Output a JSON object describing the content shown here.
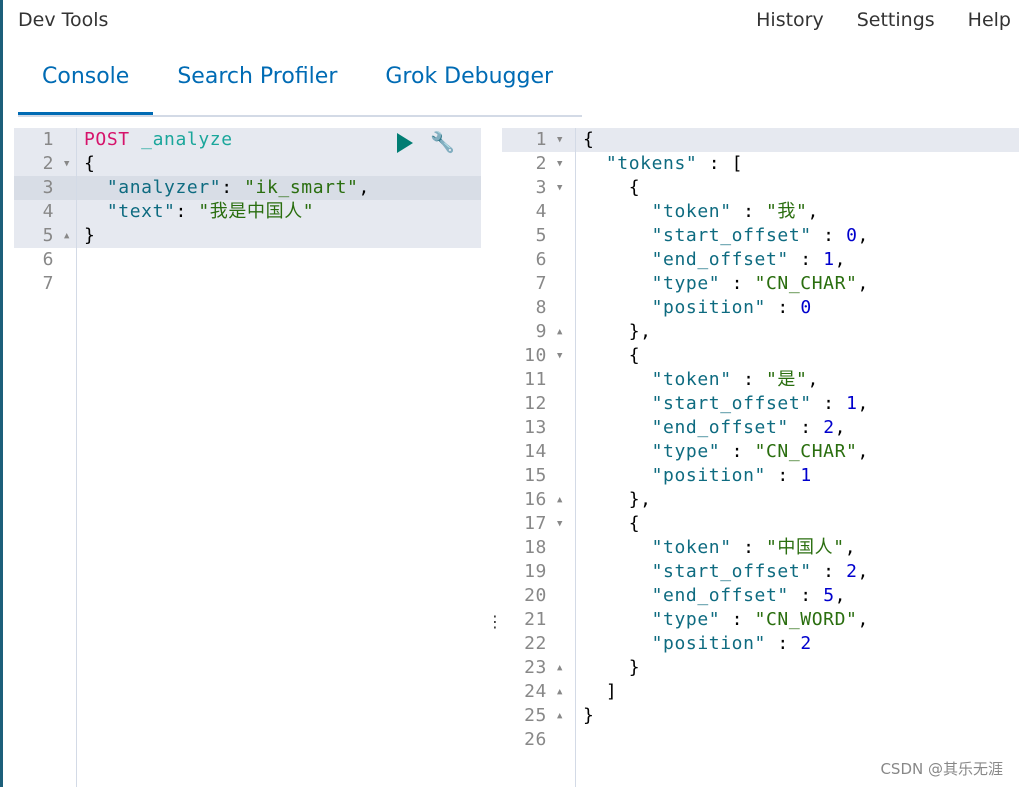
{
  "header": {
    "title": "Dev Tools",
    "nav": [
      "History",
      "Settings",
      "Help"
    ]
  },
  "tabs": [
    "Console",
    "Search Profiler",
    "Grok Debugger"
  ],
  "active_tab": 0,
  "icons": {
    "run": "play-icon",
    "settings": "wrench-icon",
    "splitter": "vertical-dots-icon"
  },
  "colors": {
    "accent": "#006bb4",
    "run": "#017d73"
  },
  "request": {
    "lines": [
      [
        [
          "POST",
          "m"
        ],
        [
          " _analyze",
          "u"
        ]
      ],
      [
        [
          "{",
          "p"
        ]
      ],
      [
        [
          "  \"analyzer\"",
          "k"
        ],
        [
          ": ",
          "p"
        ],
        [
          "\"ik_smart\"",
          "s"
        ],
        [
          ",",
          "p"
        ]
      ],
      [
        [
          "  \"text\"",
          "k"
        ],
        [
          ": ",
          "p"
        ],
        [
          "\"我是中国人\"",
          "s"
        ]
      ],
      [
        [
          "}",
          "p"
        ]
      ],
      [],
      []
    ],
    "folds": {
      "2": "down",
      "5": "up"
    }
  },
  "response": {
    "lines": [
      [
        [
          "{",
          "p"
        ]
      ],
      [
        [
          "  \"tokens\"",
          "k"
        ],
        [
          " : [",
          "p"
        ]
      ],
      [
        [
          "    {",
          "p"
        ]
      ],
      [
        [
          "      \"token\"",
          "k"
        ],
        [
          " : ",
          "p"
        ],
        [
          "\"我\"",
          "s"
        ],
        [
          ",",
          "p"
        ]
      ],
      [
        [
          "      \"start_offset\"",
          "k"
        ],
        [
          " : ",
          "p"
        ],
        [
          "0",
          "n"
        ],
        [
          ",",
          "p"
        ]
      ],
      [
        [
          "      \"end_offset\"",
          "k"
        ],
        [
          " : ",
          "p"
        ],
        [
          "1",
          "n"
        ],
        [
          ",",
          "p"
        ]
      ],
      [
        [
          "      \"type\"",
          "k"
        ],
        [
          " : ",
          "p"
        ],
        [
          "\"CN_CHAR\"",
          "s"
        ],
        [
          ",",
          "p"
        ]
      ],
      [
        [
          "      \"position\"",
          "k"
        ],
        [
          " : ",
          "p"
        ],
        [
          "0",
          "n"
        ]
      ],
      [
        [
          "    },",
          "p"
        ]
      ],
      [
        [
          "    {",
          "p"
        ]
      ],
      [
        [
          "      \"token\"",
          "k"
        ],
        [
          " : ",
          "p"
        ],
        [
          "\"是\"",
          "s"
        ],
        [
          ",",
          "p"
        ]
      ],
      [
        [
          "      \"start_offset\"",
          "k"
        ],
        [
          " : ",
          "p"
        ],
        [
          "1",
          "n"
        ],
        [
          ",",
          "p"
        ]
      ],
      [
        [
          "      \"end_offset\"",
          "k"
        ],
        [
          " : ",
          "p"
        ],
        [
          "2",
          "n"
        ],
        [
          ",",
          "p"
        ]
      ],
      [
        [
          "      \"type\"",
          "k"
        ],
        [
          " : ",
          "p"
        ],
        [
          "\"CN_CHAR\"",
          "s"
        ],
        [
          ",",
          "p"
        ]
      ],
      [
        [
          "      \"position\"",
          "k"
        ],
        [
          " : ",
          "p"
        ],
        [
          "1",
          "n"
        ]
      ],
      [
        [
          "    },",
          "p"
        ]
      ],
      [
        [
          "    {",
          "p"
        ]
      ],
      [
        [
          "      \"token\"",
          "k"
        ],
        [
          " : ",
          "p"
        ],
        [
          "\"中国人\"",
          "s"
        ],
        [
          ",",
          "p"
        ]
      ],
      [
        [
          "      \"start_offset\"",
          "k"
        ],
        [
          " : ",
          "p"
        ],
        [
          "2",
          "n"
        ],
        [
          ",",
          "p"
        ]
      ],
      [
        [
          "      \"end_offset\"",
          "k"
        ],
        [
          " : ",
          "p"
        ],
        [
          "5",
          "n"
        ],
        [
          ",",
          "p"
        ]
      ],
      [
        [
          "      \"type\"",
          "k"
        ],
        [
          " : ",
          "p"
        ],
        [
          "\"CN_WORD\"",
          "s"
        ],
        [
          ",",
          "p"
        ]
      ],
      [
        [
          "      \"position\"",
          "k"
        ],
        [
          " : ",
          "p"
        ],
        [
          "2",
          "n"
        ]
      ],
      [
        [
          "    }",
          "p"
        ]
      ],
      [
        [
          "  ]",
          "p"
        ]
      ],
      [
        [
          "}",
          "p"
        ]
      ],
      []
    ],
    "folds": {
      "1": "down",
      "2": "down",
      "3": "down",
      "9": "up",
      "10": "down",
      "16": "up",
      "17": "down",
      "23": "up",
      "24": "up",
      "25": "up"
    }
  },
  "watermark": "CSDN @其乐无涯"
}
